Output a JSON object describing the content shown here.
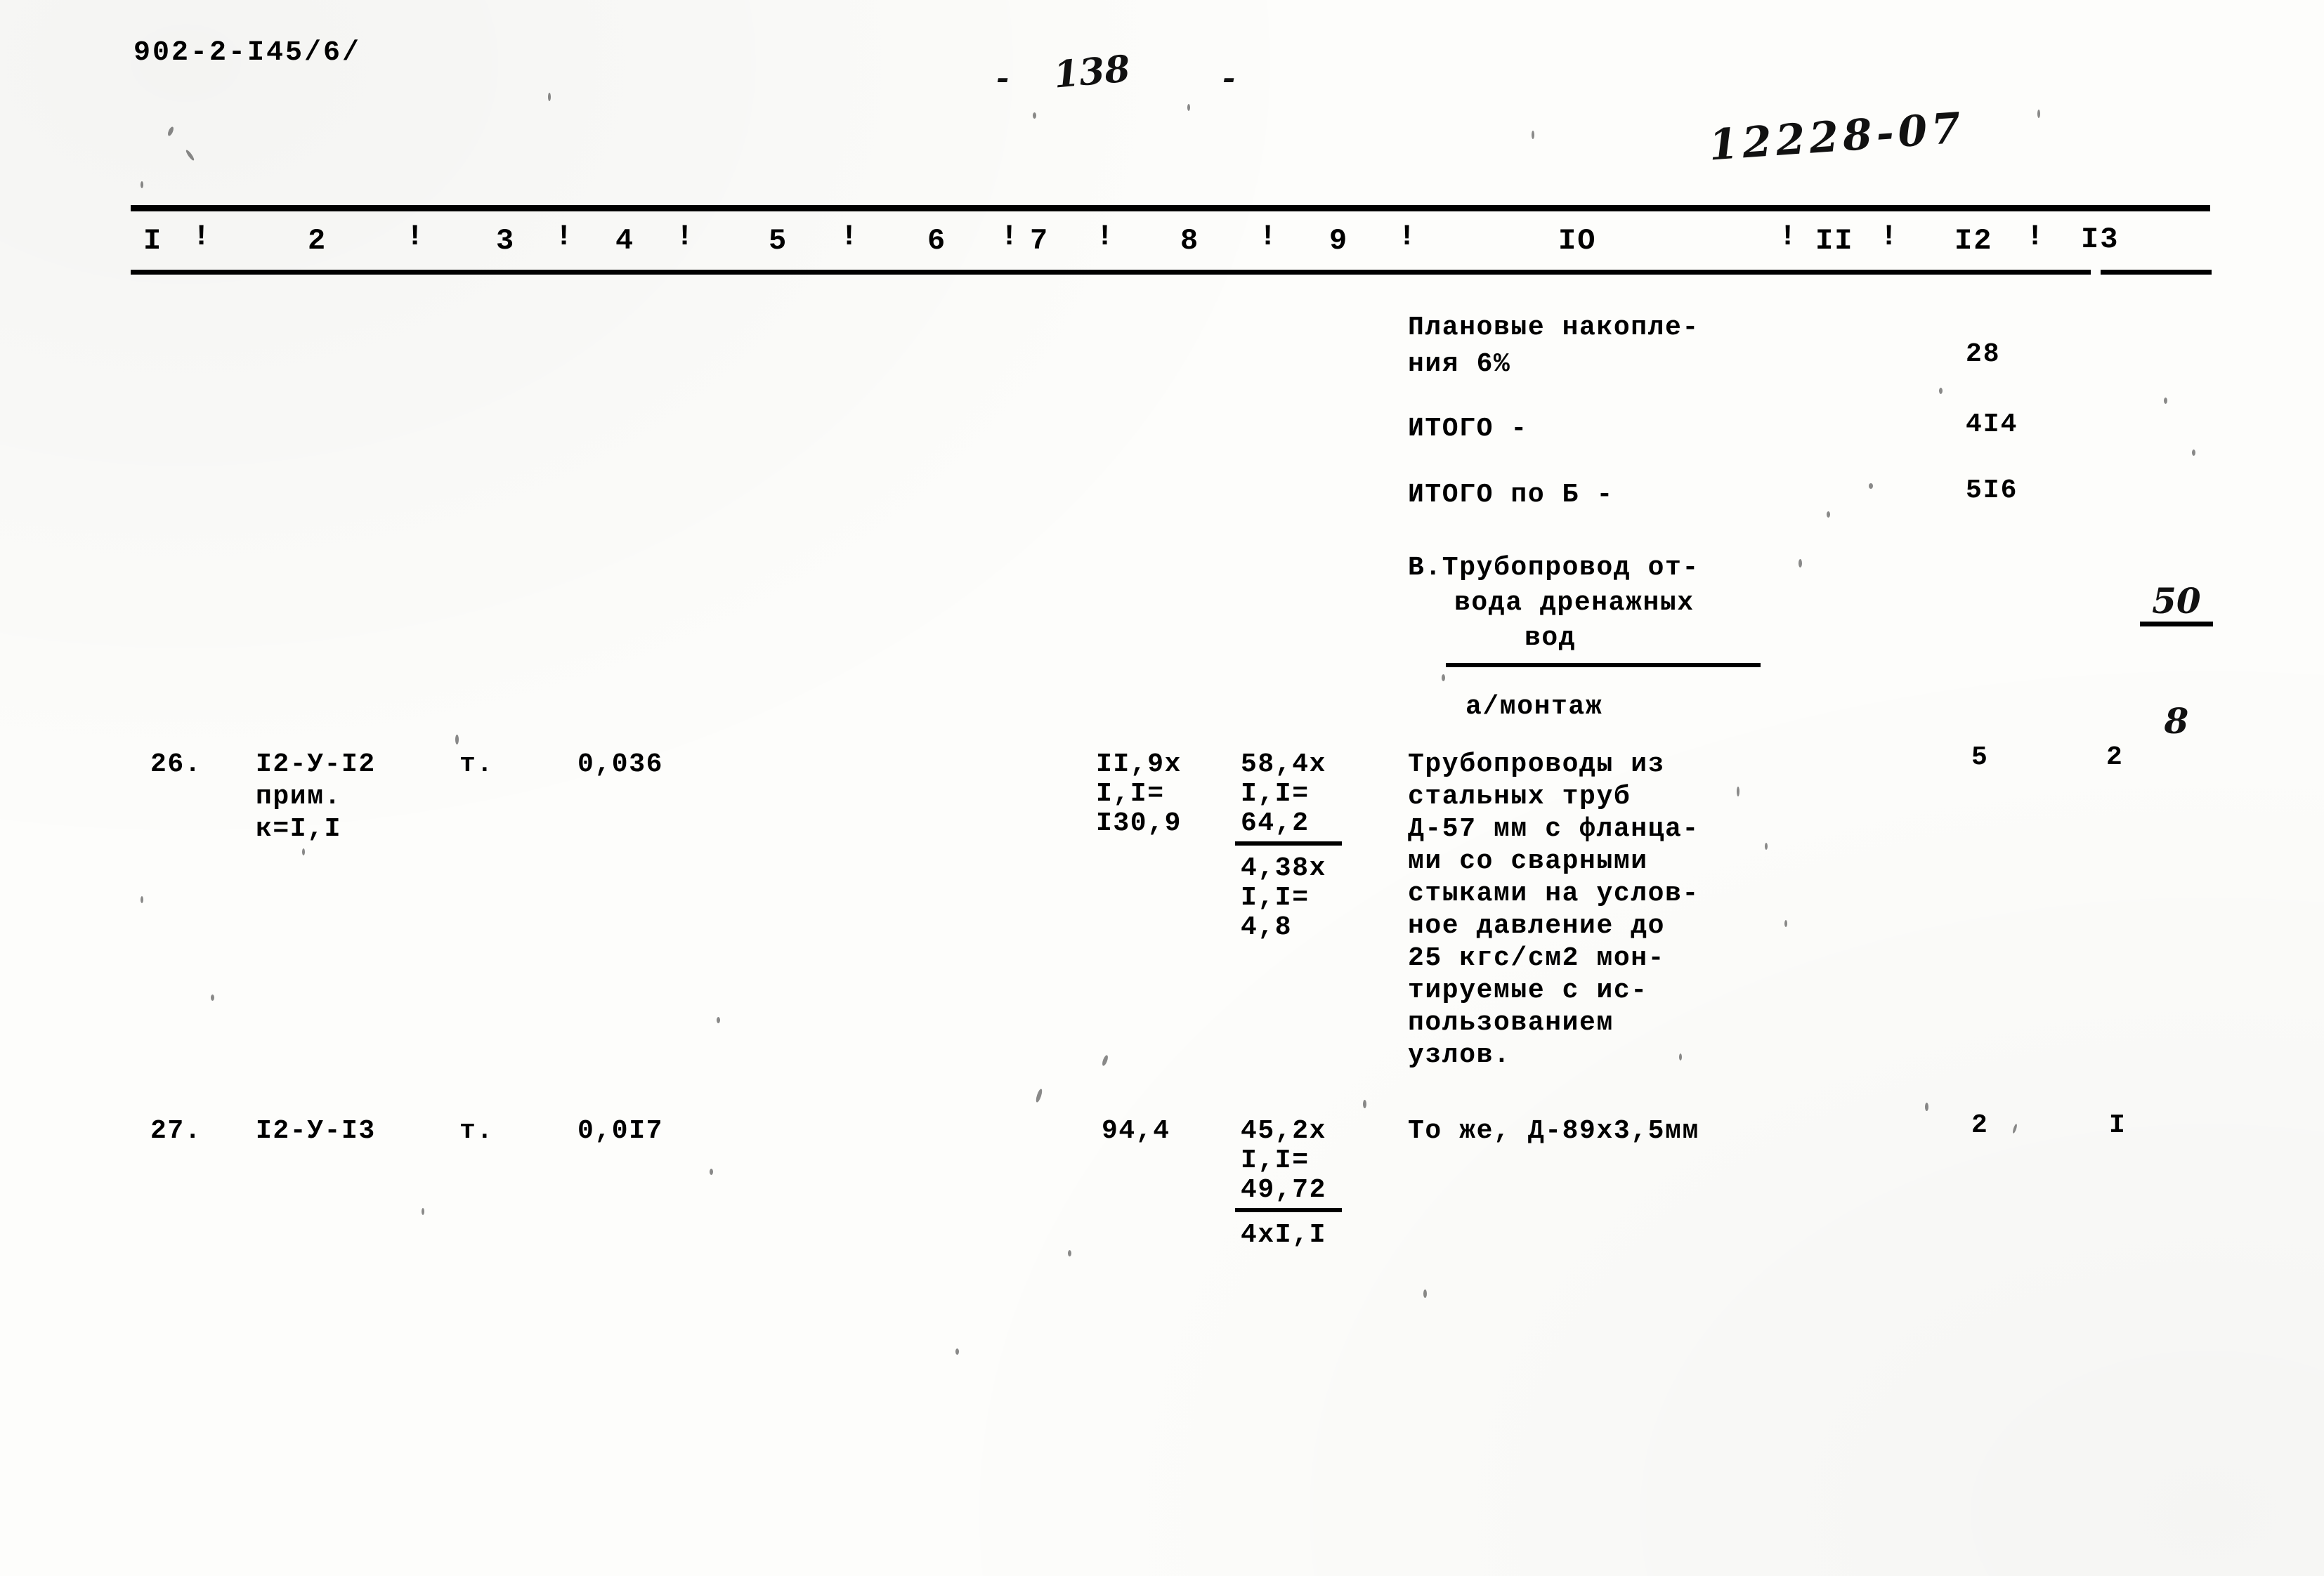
{
  "document": {
    "series_code": "902-2-I45/6/",
    "page_marker_left": "-",
    "page_number": "138",
    "page_marker_right": "-",
    "archive_stamp": "12228-07"
  },
  "table": {
    "column_numbers": [
      "I",
      "2",
      "3",
      "4",
      "5",
      "6",
      "7",
      "8",
      "9",
      "IO",
      "II",
      "I2",
      "I3"
    ],
    "separator": "!",
    "summary_rows": [
      {
        "label_line1": "Плановые накопле-",
        "label_line2": "ния 6%",
        "col12": "28",
        "col13": ""
      },
      {
        "label_line1": "ИТОГО -",
        "label_line2": "",
        "col12": "4I4",
        "col13": ""
      },
      {
        "label_line1": "ИТОГО по Б -",
        "label_line2": "",
        "col12": "5I6",
        "col13_fraction_numerator": "50",
        "col13_fraction_denominator": "8"
      }
    ],
    "section_heading": {
      "line1": "В.Трубопровод от-",
      "line2": "вода дренажных",
      "line3": "вод",
      "subheading": "а/монтаж"
    },
    "rows": [
      {
        "col1_no": "26.",
        "col2_code": "I2-У-I2",
        "col2_note1": "прим.",
        "col2_note2": "к=I,I",
        "col3_unit": "т.",
        "col4_qty": "0,036",
        "col8_lines": [
          "II,9x",
          "I,I=",
          "I30,9"
        ],
        "col9_lines": [
          "58,4x",
          "I,I=",
          "64,2"
        ],
        "col9_underline_at": 2,
        "col9_extra_lines": [
          "4,38x",
          "I,I=",
          "4,8"
        ],
        "col10_description": [
          "Трубопроводы из",
          "стальных труб",
          "Д-57 мм с фланца-",
          "ми со сварными",
          "стыками на услов-",
          "ное давление до",
          "25 кгс/см2 мон-",
          "тируемые с ис-",
          "пользованием",
          "узлов."
        ],
        "col12": "5",
        "col13": "2"
      },
      {
        "col1_no": "27.",
        "col2_code": "I2-У-I3",
        "col2_note1": "",
        "col2_note2": "",
        "col3_unit": "т.",
        "col4_qty": "0,0I7",
        "col8_lines": [
          "94,4"
        ],
        "col9_lines": [
          "45,2x",
          "I,I=",
          "49,72"
        ],
        "col9_underline_at": 2,
        "col9_extra_lines": [
          "4xI,I"
        ],
        "col10_description": [
          "То же, Д-89х3,5мм"
        ],
        "col12": "2",
        "col13": "I"
      }
    ]
  }
}
